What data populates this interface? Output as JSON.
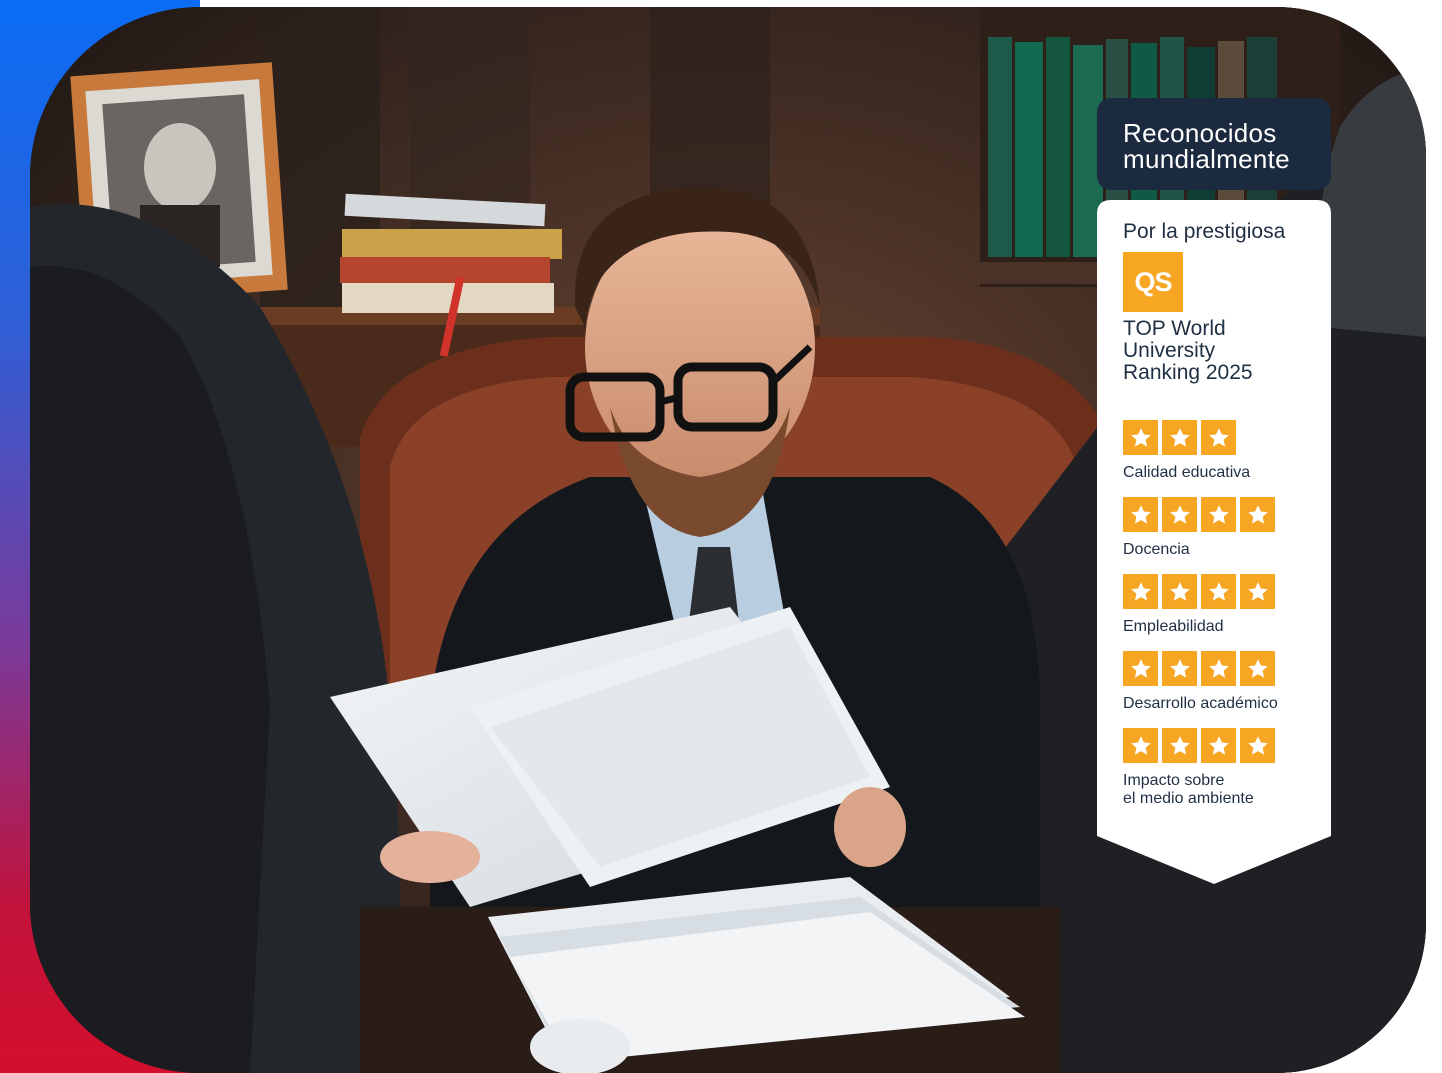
{
  "badge": {
    "header_line1": "Reconocidos",
    "header_line2": "mundialmente",
    "intro": "Por la prestigiosa",
    "logo_text": "QS",
    "ranking_line1": "TOP World",
    "ranking_line2": "University",
    "ranking_line3": "Ranking 2025",
    "categories": [
      {
        "stars": 3,
        "label_line1": "Calidad educativa",
        "label_line2": ""
      },
      {
        "stars": 4,
        "label_line1": "Docencia",
        "label_line2": ""
      },
      {
        "stars": 4,
        "label_line1": "Empleabilidad",
        "label_line2": ""
      },
      {
        "stars": 4,
        "label_line1": "Desarrollo académico",
        "label_line2": ""
      },
      {
        "stars": 4,
        "label_line1": "Impacto sobre",
        "label_line2": "el medio ambiente"
      }
    ]
  },
  "colors": {
    "header_bg": "#1b2a3f",
    "star_bg": "#f6a623",
    "qs_orange": "#f6a623",
    "accent_blue": "#0a6cf5",
    "accent_red": "#d40f2e"
  }
}
